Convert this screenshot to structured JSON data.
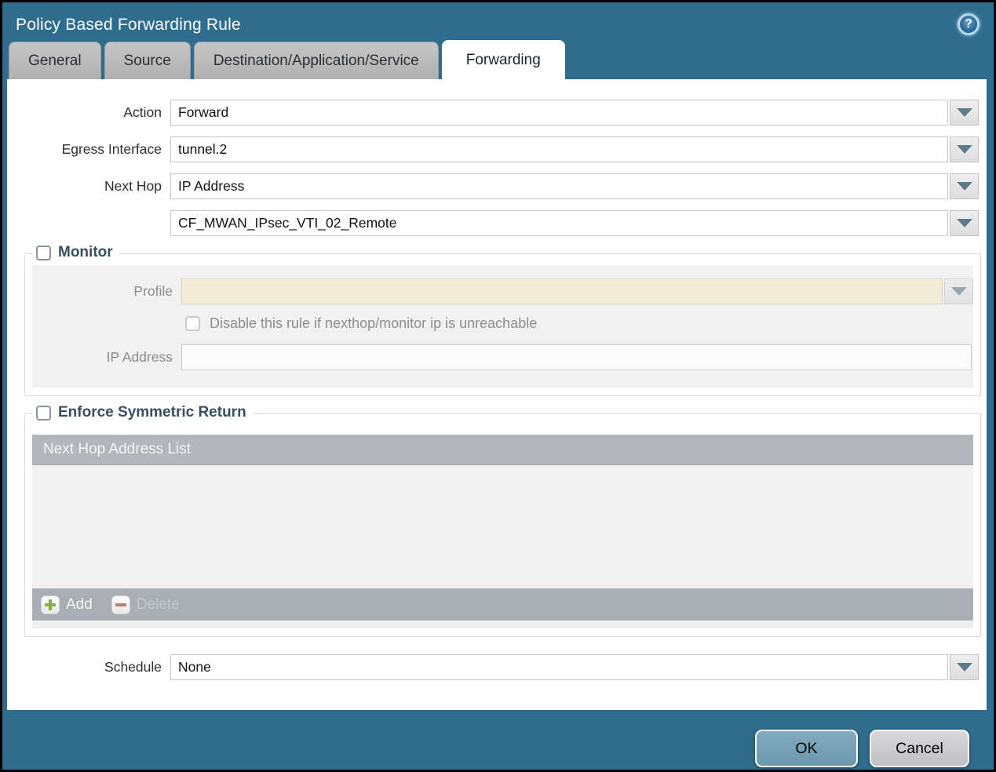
{
  "window": {
    "title": "Policy Based Forwarding Rule"
  },
  "icons": {
    "help": "?"
  },
  "tabs": [
    {
      "label": "General",
      "active": false
    },
    {
      "label": "Source",
      "active": false
    },
    {
      "label": "Destination/Application/Service",
      "active": false
    },
    {
      "label": "Forwarding",
      "active": true
    }
  ],
  "form": {
    "action": {
      "label": "Action",
      "value": "Forward"
    },
    "egress_interface": {
      "label": "Egress Interface",
      "value": "tunnel.2"
    },
    "next_hop": {
      "label": "Next Hop",
      "value": "IP Address"
    },
    "next_hop_address": {
      "value": "CF_MWAN_IPsec_VTI_02_Remote"
    },
    "schedule": {
      "label": "Schedule",
      "value": "None"
    }
  },
  "monitor": {
    "label": "Monitor",
    "checked": false,
    "profile": {
      "label": "Profile",
      "value": ""
    },
    "disable_rule": {
      "label": "Disable this rule if nexthop/monitor ip is unreachable",
      "checked": false
    },
    "ip_address": {
      "label": "IP Address",
      "value": ""
    }
  },
  "enforce_symmetric_return": {
    "label": "Enforce Symmetric Return",
    "checked": false,
    "table": {
      "header": "Next Hop Address List",
      "rows": []
    },
    "add_label": "Add",
    "delete_label": "Delete",
    "delete_enabled": false
  },
  "footer": {
    "ok_label": "OK",
    "cancel_label": "Cancel"
  },
  "colors": {
    "titlebar_bg": "#2e6d8d",
    "active_tab_bg": "#ffffff",
    "inactive_tab_bg": "#b8b8b8",
    "section_heading": "#374f5e",
    "profile_field_bg": "#f3edd8",
    "table_header_bg": "#b3b7bb",
    "table_footer_bg": "#a9aeb3",
    "add_icon_green": "#8aab3f",
    "delete_icon_red": "#b5826e",
    "ok_button_bg": "#74a0b6",
    "cancel_button_bg": "#c8c8cc",
    "dropdown_arrow": "#5e7b8e"
  }
}
